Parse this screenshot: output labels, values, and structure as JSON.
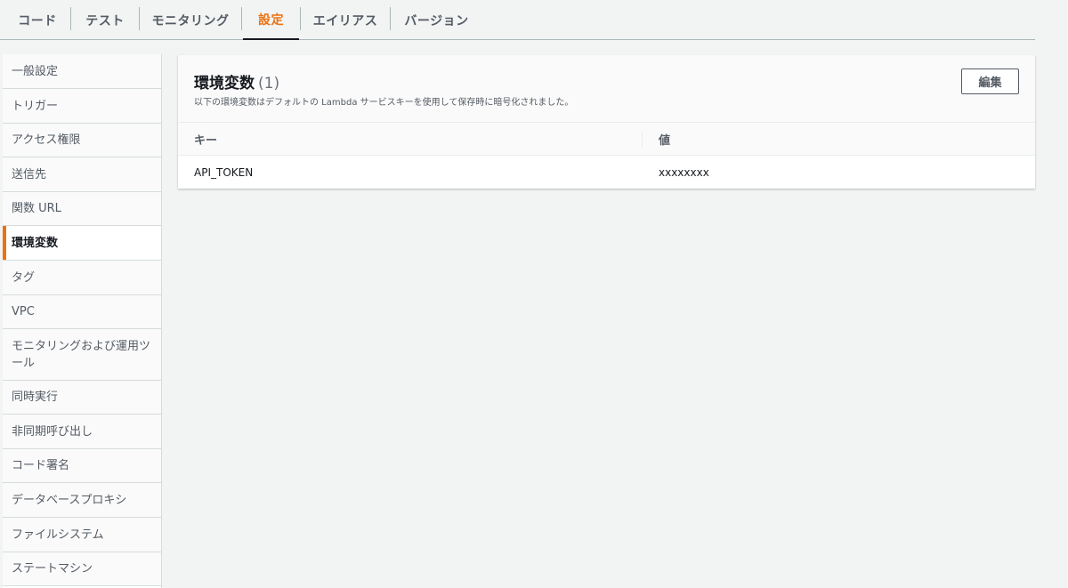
{
  "tabs": [
    {
      "label": "コード",
      "active": false
    },
    {
      "label": "テスト",
      "active": false
    },
    {
      "label": "モニタリング",
      "active": false
    },
    {
      "label": "設定",
      "active": true
    },
    {
      "label": "エイリアス",
      "active": false
    },
    {
      "label": "バージョン",
      "active": false
    }
  ],
  "sidebar": {
    "items": [
      {
        "label": "一般設定",
        "active": false
      },
      {
        "label": "トリガー",
        "active": false
      },
      {
        "label": "アクセス権限",
        "active": false
      },
      {
        "label": "送信先",
        "active": false
      },
      {
        "label": "関数 URL",
        "active": false
      },
      {
        "label": "環境変数",
        "active": true
      },
      {
        "label": "タグ",
        "active": false
      },
      {
        "label": "VPC",
        "active": false
      },
      {
        "label": "モニタリングおよび運用ツール",
        "active": false
      },
      {
        "label": "同時実行",
        "active": false
      },
      {
        "label": "非同期呼び出し",
        "active": false
      },
      {
        "label": "コード署名",
        "active": false
      },
      {
        "label": "データベースプロキシ",
        "active": false
      },
      {
        "label": "ファイルシステム",
        "active": false
      },
      {
        "label": "ステートマシン",
        "active": false
      }
    ]
  },
  "panel": {
    "title": "環境変数",
    "count": "(1)",
    "description": "以下の環境変数はデフォルトの Lambda サービスキーを使用して保存時に暗号化されました。",
    "edit_label": "編集",
    "columns": [
      "キー",
      "値"
    ],
    "rows": [
      {
        "key": "API_TOKEN",
        "value": "xxxxxxxx"
      }
    ]
  },
  "colors": {
    "accent": "#ec7211",
    "text": "#16191f",
    "muted": "#545b64",
    "background": "#f2f3f3"
  }
}
